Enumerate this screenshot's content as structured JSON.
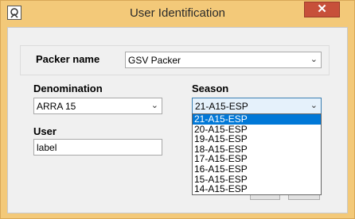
{
  "window": {
    "title": "User Identification",
    "close_symbol": "✕",
    "app_icon": "app-logo-icon"
  },
  "packer": {
    "label": "Packer name",
    "value": "GSV Packer"
  },
  "denomination": {
    "label": "Denomination",
    "value": "ARRA 15"
  },
  "season": {
    "label": "Season",
    "value": "21-A15-ESP",
    "options": [
      "21-A15-ESP",
      "20-A15-ESP",
      "19-A15-ESP",
      "18-A15-ESP",
      "17-A15-ESP",
      "16-A15-ESP",
      "15-A15-ESP",
      "14-A15-ESP"
    ],
    "selected_index": 0
  },
  "user": {
    "label": "User",
    "value": "label"
  },
  "colors": {
    "title_bar": "#f3c979",
    "close_button": "#c7503a",
    "selection": "#0078d7"
  }
}
